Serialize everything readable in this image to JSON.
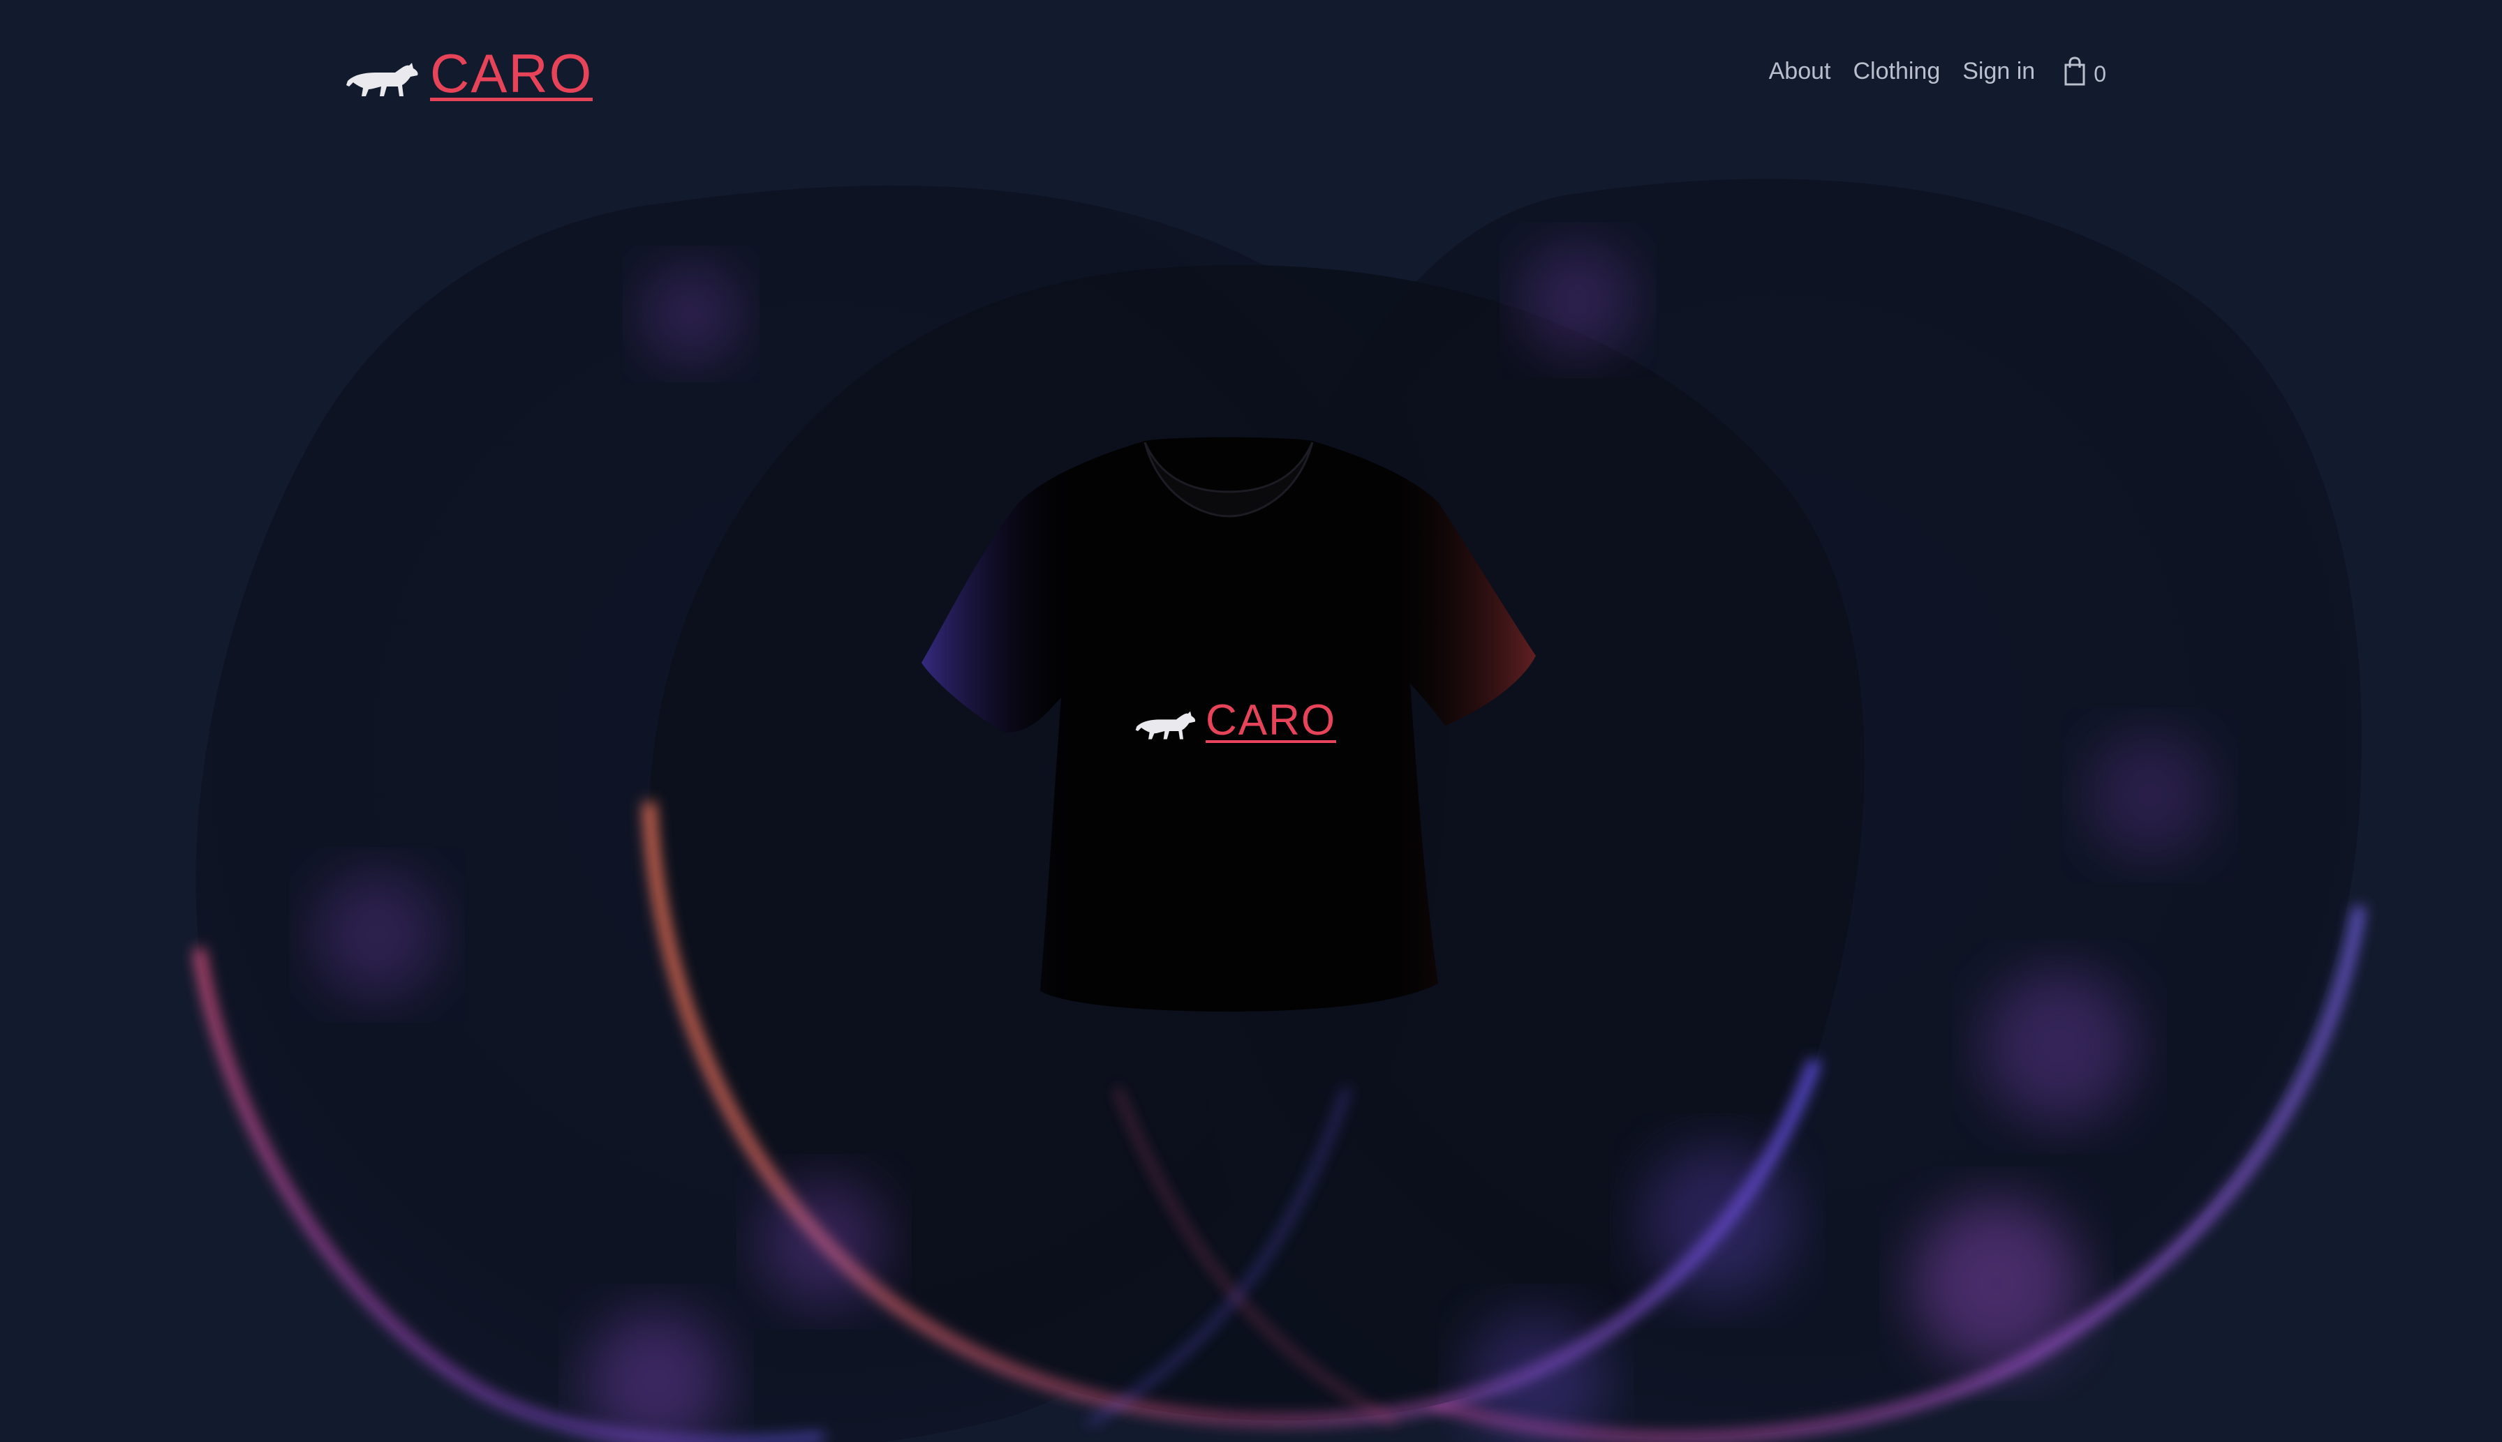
{
  "brand": {
    "name": "CARO",
    "accent_color": "#e74359",
    "logo_icon": "wolf-icon"
  },
  "nav": {
    "items": [
      {
        "label": "About"
      },
      {
        "label": "Clothing"
      },
      {
        "label": "Sign in"
      }
    ],
    "cart": {
      "icon": "shopping-bag-icon",
      "count": "0"
    }
  },
  "hero": {
    "product": "t-shirt",
    "shirt_print": "CARO",
    "background_color": "#121a2d"
  }
}
